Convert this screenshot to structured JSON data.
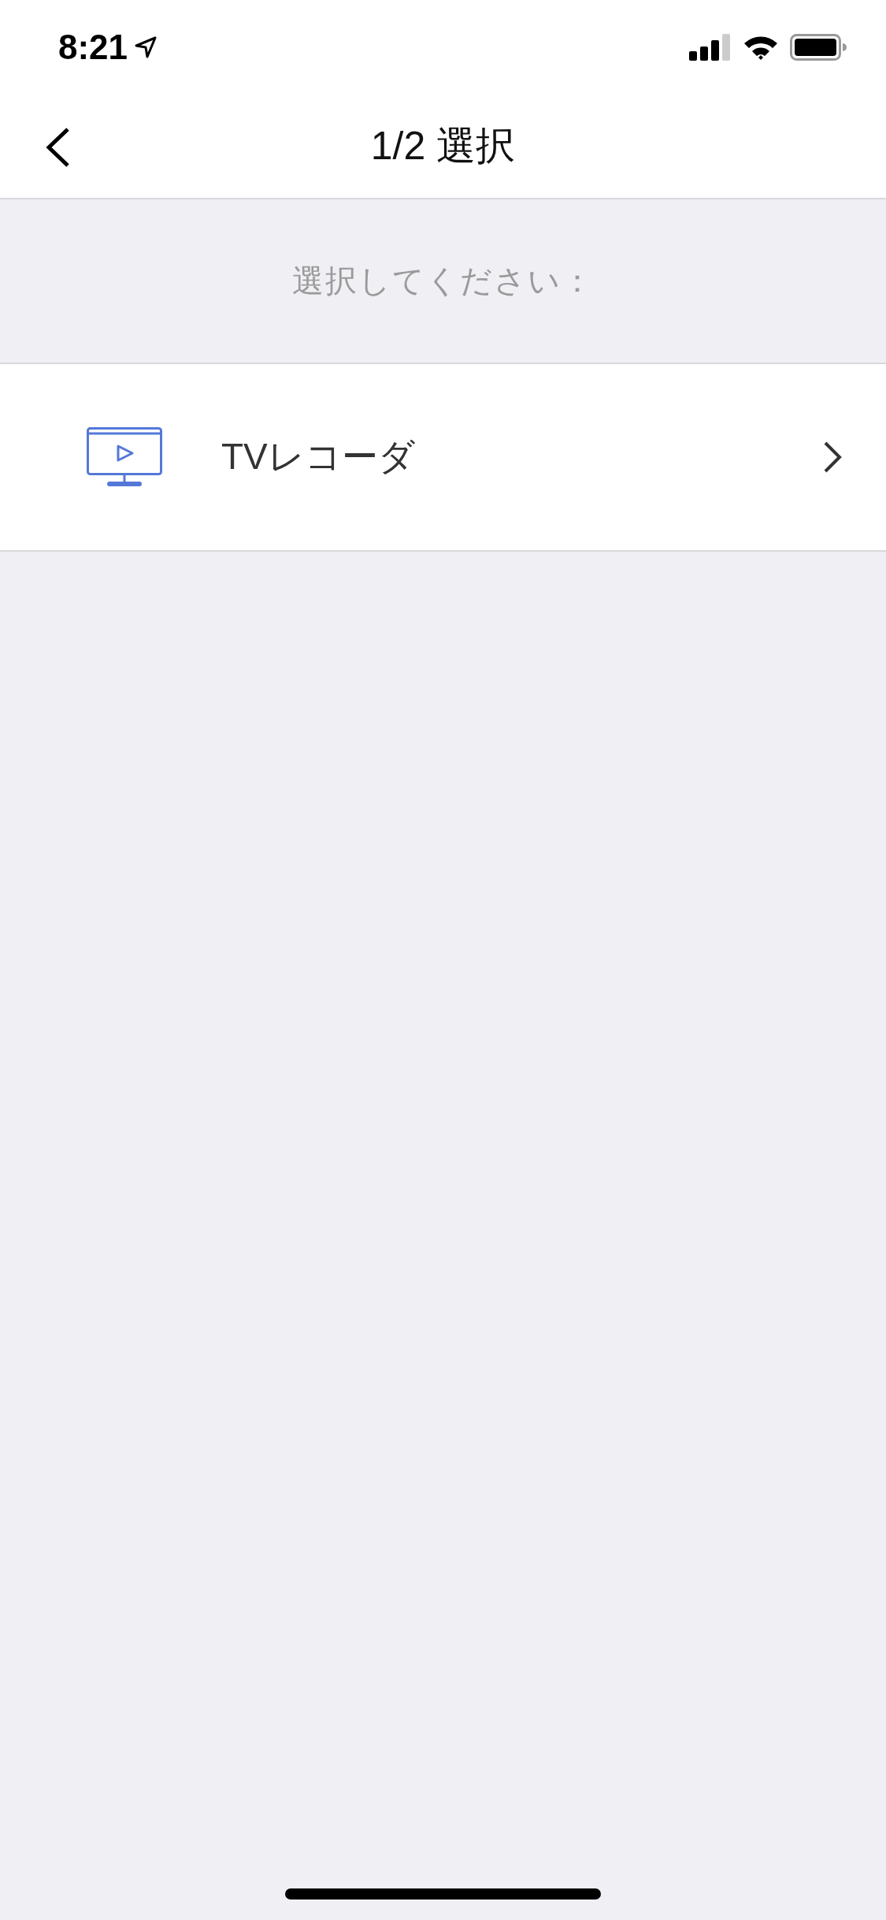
{
  "status_bar": {
    "time": "8:21"
  },
  "nav_bar": {
    "title": "1/2 選択"
  },
  "prompt": "選択してください：",
  "items": [
    {
      "label": "TVレコーダ"
    }
  ]
}
